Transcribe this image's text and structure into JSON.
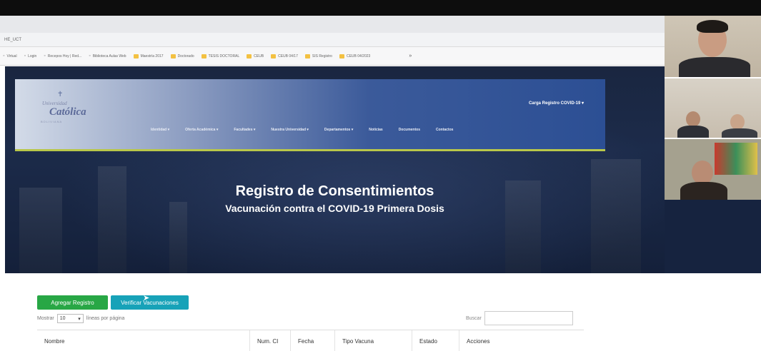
{
  "browser": {
    "url": "HE_UCT",
    "bookmarks": [
      {
        "icon": "glyph",
        "label": "Virtual"
      },
      {
        "icon": "glyph",
        "label": "Login"
      },
      {
        "icon": "glyph",
        "label": "Recepos Hoy | Red..."
      },
      {
        "icon": "glyph",
        "label": "Biblioteca Aulas Web"
      },
      {
        "icon": "folder",
        "label": "Maestría 2017"
      },
      {
        "icon": "folder",
        "label": "Doctorado"
      },
      {
        "icon": "folder",
        "label": "TESIS DOCTORAL"
      },
      {
        "icon": "folder",
        "label": "CEUB"
      },
      {
        "icon": "folder",
        "label": "CEUB 04/17"
      },
      {
        "icon": "folder",
        "label": "SIS Registro"
      },
      {
        "icon": "folder",
        "label": "CEUB 04/2023"
      }
    ],
    "more": "»"
  },
  "site": {
    "logo": {
      "line1": "Universidad",
      "line2": "Católica",
      "line3": "BOLIVIANA"
    },
    "carga": "Carga Registro COVID-19 ▾",
    "menu": [
      "Identidad ▾",
      "Oferta Académica ▾",
      "Facultades ▾",
      "Nuestra Universidad ▾",
      "Departamentos ▾",
      "Noticias",
      "Documentos",
      "Contactos"
    ]
  },
  "hero": {
    "title": "Registro de Consentimientos",
    "subtitle": "Vacunación contra el COVID-19 Primera Dosis"
  },
  "controls": {
    "add_label": "Agregar Registro",
    "verify_label": "Verificar Vacunaciones",
    "length_prefix": "Mostrar",
    "length_value": "10",
    "length_suffix": "líneas por página",
    "search_label": "Buscar"
  },
  "table": {
    "columns": [
      "Nombre",
      "Num. CI",
      "Fecha",
      "Tipo Vacuna",
      "Estado",
      "Acciones"
    ]
  },
  "colors": {
    "add": "#28a745",
    "verify": "#17a2b8",
    "navAccent": "#b9c74a"
  }
}
